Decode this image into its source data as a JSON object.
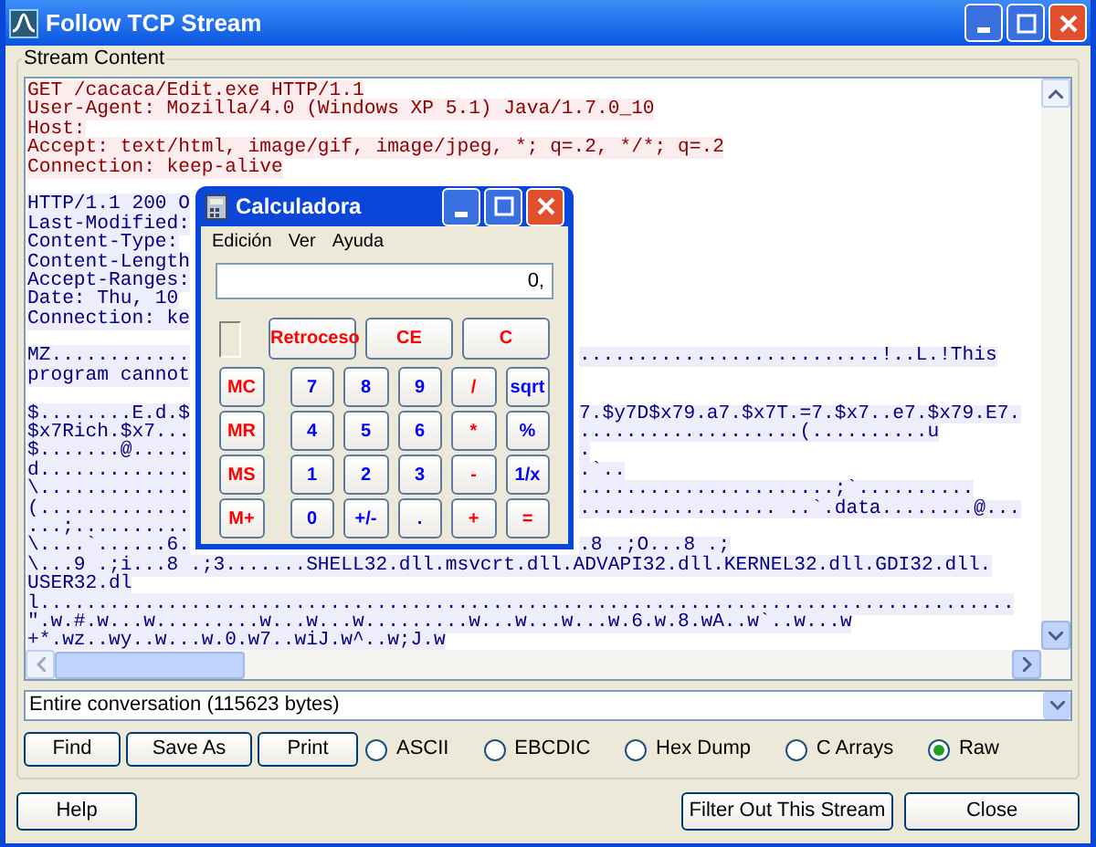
{
  "window": {
    "title": "Follow TCP Stream"
  },
  "stream": {
    "label": "Stream Content",
    "blocks": [
      {
        "kind": "client",
        "lines": [
          {
            "left": "GET /cacaca/Edit.exe HTTP/1.1"
          },
          {
            "left": "User-Agent: Mozilla/4.0 (Windows XP 5.1) Java/1.7.0_10"
          },
          {
            "left": "Host:"
          },
          {
            "left": "Accept: text/html, image/gif, image/jpeg, *; q=.2, */*; q=.2"
          },
          {
            "left": "Connection: keep-alive"
          }
        ]
      },
      {
        "kind": "server",
        "lines": [
          {
            "left": "HTTP/1.1 200 O"
          },
          {
            "left": "Last-Modified:"
          },
          {
            "left": "Content-Type:"
          },
          {
            "left": "Content-Length"
          },
          {
            "left": "Accept-Ranges:"
          },
          {
            "left": "Date: Thu, 10"
          },
          {
            "left": "Connection: ke"
          }
        ]
      },
      {
        "kind": "server",
        "lines": [
          {
            "left": "MZ............",
            "right": "..........................!..L.!This"
          },
          {
            "left": "program cannot"
          }
        ]
      },
      {
        "kind": "server",
        "lines": [
          {
            "left": "$........E.d.$",
            "right": "7.$y7D$x79.a7.$x7T.=7.$x7..e7.$x79.E7."
          },
          {
            "left": "$x7Rich.$x7...",
            "right": "...................(..........u"
          },
          {
            "left": "$.......@.....",
            "right": "."
          },
          {
            "left": "d.............",
            "right": ".`.."
          },
          {
            "left": "\\.............",
            "right": "......................;`.........."
          },
          {
            "left": "(.............",
            "right": "................. ..`.data........@..."
          },
          {
            "left": "...;.........."
          },
          {
            "left": "\\....`......6.",
            "right": ".8 .;O...8 .;"
          },
          {
            "left": "\\...9 .;i...8 .;3.......SHELL32.dll.msvcrt.dll.ADVAPI32.dll.KERNEL32.dll.GDI32.dll."
          },
          {
            "left": "USER32.dl"
          },
          {
            "left": "l...................................................................................."
          },
          {
            "left": "\".w.#.w...w.........w...w...w.........w...w...w...w.6.w.8.wA..w`..w...w"
          },
          {
            "left": "+*.wz..wy..w...w.0.w7..wiJ.w^..w;J.w"
          }
        ]
      }
    ]
  },
  "conversation_select": {
    "value": "Entire conversation (115623 bytes)"
  },
  "action_buttons": [
    "Find",
    "Save As",
    "Print"
  ],
  "formats": [
    {
      "label": "ASCII",
      "selected": false
    },
    {
      "label": "EBCDIC",
      "selected": false
    },
    {
      "label": "Hex Dump",
      "selected": false
    },
    {
      "label": "C Arrays",
      "selected": false
    },
    {
      "label": "Raw",
      "selected": true
    }
  ],
  "footer_buttons": {
    "left": [
      "Help"
    ],
    "right": [
      "Filter Out This Stream",
      "Close"
    ]
  },
  "calculator": {
    "title": "Calculadora",
    "menu": [
      "Edición",
      "Ver",
      "Ayuda"
    ],
    "display": "0,",
    "top_buttons": [
      {
        "label": "Retroceso",
        "color": "#ff0000"
      },
      {
        "label": "CE",
        "color": "#ff0000"
      },
      {
        "label": "C",
        "color": "#ff0000"
      }
    ],
    "rows": [
      [
        {
          "label": "MC",
          "color": "#ff0000"
        },
        {
          "label": "7",
          "color": "#0000ff"
        },
        {
          "label": "8",
          "color": "#0000ff"
        },
        {
          "label": "9",
          "color": "#0000ff"
        },
        {
          "label": "/",
          "color": "#ff0000"
        },
        {
          "label": "sqrt",
          "color": "#0000ff"
        }
      ],
      [
        {
          "label": "MR",
          "color": "#ff0000"
        },
        {
          "label": "4",
          "color": "#0000ff"
        },
        {
          "label": "5",
          "color": "#0000ff"
        },
        {
          "label": "6",
          "color": "#0000ff"
        },
        {
          "label": "*",
          "color": "#ff0000"
        },
        {
          "label": "%",
          "color": "#0000ff"
        }
      ],
      [
        {
          "label": "MS",
          "color": "#ff0000"
        },
        {
          "label": "1",
          "color": "#0000ff"
        },
        {
          "label": "2",
          "color": "#0000ff"
        },
        {
          "label": "3",
          "color": "#0000ff"
        },
        {
          "label": "-",
          "color": "#ff0000"
        },
        {
          "label": "1/x",
          "color": "#0000ff"
        }
      ],
      [
        {
          "label": "M+",
          "color": "#ff0000"
        },
        {
          "label": "0",
          "color": "#0000ff"
        },
        {
          "label": "+/-",
          "color": "#0000ff"
        },
        {
          "label": ".",
          "color": "#0000ff"
        },
        {
          "label": "+",
          "color": "#ff0000"
        },
        {
          "label": "=",
          "color": "#ff0000"
        }
      ]
    ]
  }
}
